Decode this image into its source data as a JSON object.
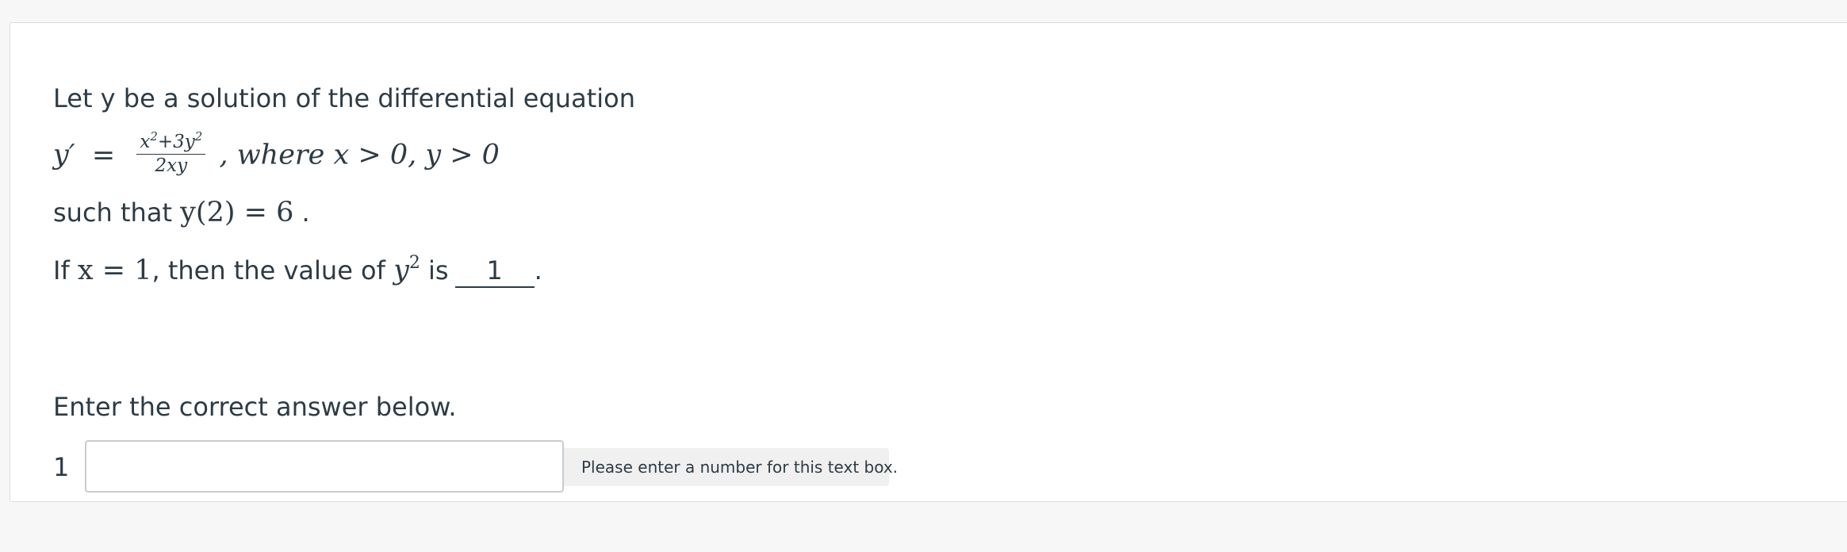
{
  "question": {
    "intro": "Let y be a solution of the differential equation",
    "equation": {
      "lhs": "y′",
      "equals": "=",
      "numerator_x": "x",
      "numerator_x_exp": "2",
      "numerator_plus": "+3y",
      "numerator_y_exp": "2",
      "denominator": "2xy",
      "condition": ", where x > 0, y > 0"
    },
    "condition_prefix": "such that ",
    "condition_math": "y(2) = 6",
    "condition_suffix": " .",
    "ask_prefix": "If ",
    "ask_math": "x = 1",
    "ask_middle": ", then the value of ",
    "ask_var": "y",
    "ask_var_exp": "2",
    "ask_is": " is",
    "blank_value": "1",
    "ask_suffix": "."
  },
  "answer": {
    "prompt": "Enter the correct answer below.",
    "item_number": "1",
    "input_value": "",
    "input_placeholder": "",
    "hint": "Please enter a number for this text box."
  }
}
